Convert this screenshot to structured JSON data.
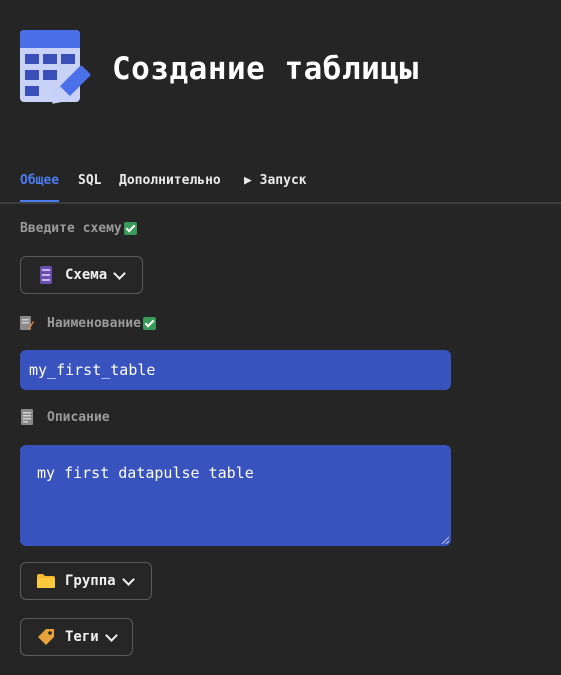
{
  "page": {
    "title": "Создание таблицы"
  },
  "tabs": [
    {
      "label": "Общее",
      "active": true
    },
    {
      "label": "SQL",
      "active": false
    },
    {
      "label": "Дополнительно",
      "active": false
    },
    {
      "label": "▶ Запуск",
      "active": false
    }
  ],
  "schema": {
    "label": "Введите схему",
    "button_label": "Схема"
  },
  "name": {
    "label": "Наименование",
    "value": "my_first_table"
  },
  "description": {
    "label": "Описание",
    "value": "my first datapulse table"
  },
  "group": {
    "button_label": "Группа"
  },
  "tags": {
    "button_label": "Теги"
  },
  "colors": {
    "accent": "#4c7cf0",
    "input_bg": "#3852be",
    "background": "#252525",
    "check": "#3a9a5a"
  }
}
